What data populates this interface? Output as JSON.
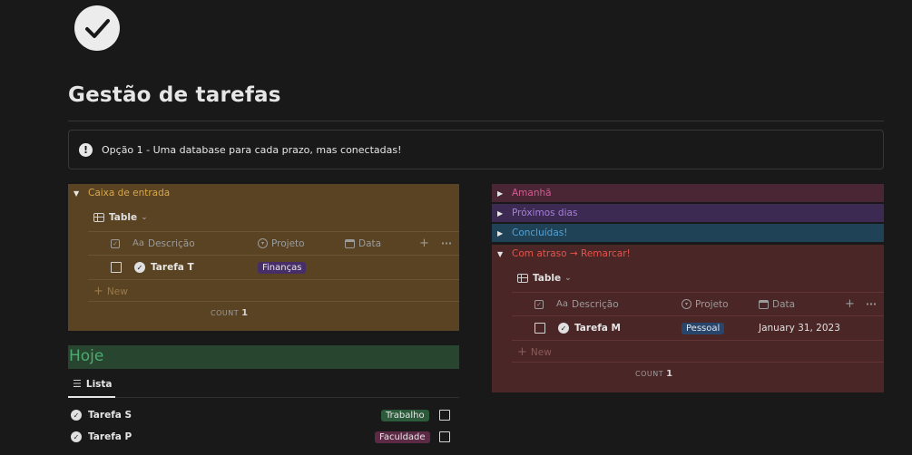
{
  "page": {
    "title": "Gestão de tarefas",
    "icon": "check-circle-icon"
  },
  "callout": {
    "icon": "exclamation-icon",
    "text": "Opção 1 - Uma database para cada prazo, mas conectadas!"
  },
  "left_toggle": {
    "title": "Caixa de entrada",
    "color": "#d9a74a",
    "bg": "#5a4322",
    "view": "Table",
    "columns": {
      "name": "Descrição",
      "project": "Projeto",
      "date": "Data"
    },
    "rows": [
      {
        "name": "Tarefa T",
        "project": "Finanças",
        "project_color": "#482e69",
        "date": ""
      }
    ],
    "new_label": "New",
    "count_label": "COUNT",
    "count_value": "1"
  },
  "hoje": {
    "title": "Hoje",
    "view": "Lista",
    "items": [
      {
        "name": "Tarefa S",
        "tag": "Trabalho",
        "tag_color": "#2b5b3a"
      },
      {
        "name": "Tarefa P",
        "tag": "Faculdade",
        "tag_color": "#5c2a45"
      }
    ]
  },
  "right_toggles": [
    {
      "title": "Amanhã",
      "color": "#d35c93",
      "bg": "#4a2634"
    },
    {
      "title": "Próximos dias",
      "color": "#a77ed9",
      "bg": "#3c2a52"
    },
    {
      "title": "Concluídas!",
      "color": "#52a3d6",
      "bg": "#1f4257"
    }
  ],
  "overdue": {
    "title": "Com atraso → Remarcar!",
    "color": "#e5534b",
    "bg": "#4b2626",
    "view": "Table",
    "columns": {
      "name": "Descrição",
      "project": "Projeto",
      "date": "Data"
    },
    "rows": [
      {
        "name": "Tarefa M",
        "project": "Pessoal",
        "project_color": "#28456c",
        "date": "January 31, 2023"
      }
    ],
    "new_label": "New",
    "count_label": "COUNT",
    "count_value": "1"
  }
}
